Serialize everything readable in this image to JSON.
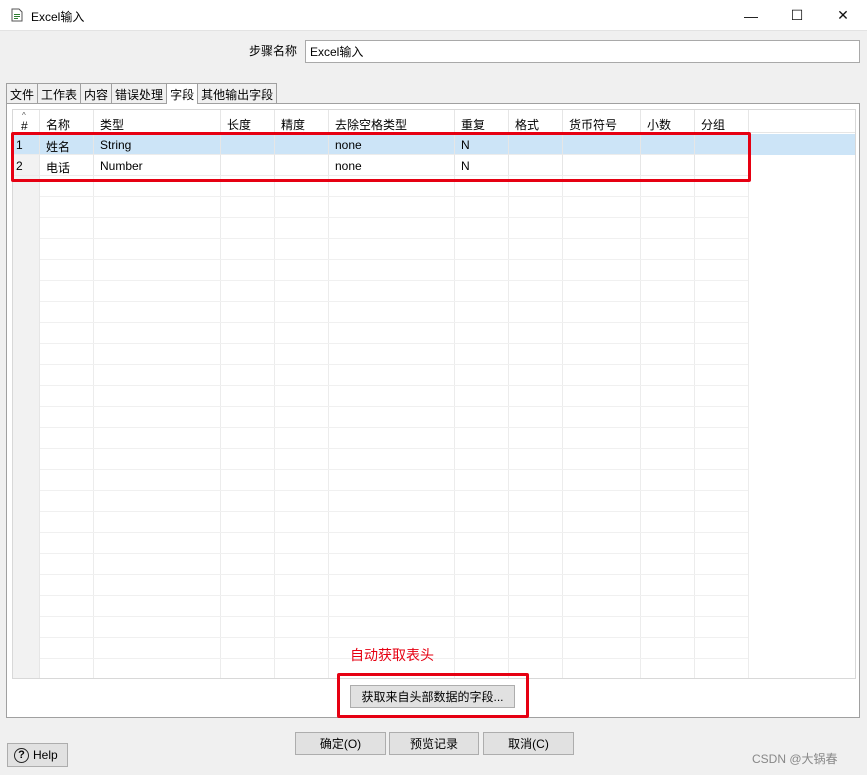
{
  "window": {
    "title": "Excel输入",
    "minimize_glyph": "—",
    "maximize_glyph": "☐",
    "close_glyph": "✕"
  },
  "step": {
    "label": "步骤名称",
    "value": "Excel输入"
  },
  "tabs": [
    "文件",
    "工作表",
    "内容",
    "错误处理",
    "字段",
    "其他输出字段"
  ],
  "active_tab": "字段",
  "table": {
    "sort_glyph": "^",
    "columns": [
      "#",
      "名称",
      "类型",
      "长度",
      "精度",
      "去除空格类型",
      "重复",
      "格式",
      "货币符号",
      "小数",
      "分组"
    ],
    "rows": [
      [
        "1",
        "姓名",
        "String",
        "",
        "",
        "none",
        "N",
        "",
        "",
        "",
        ""
      ],
      [
        "2",
        "电话",
        "Number",
        "",
        "",
        "none",
        "N",
        "",
        "",
        "",
        ""
      ]
    ]
  },
  "annotation": "自动获取表头",
  "buttons": {
    "get_fields": "获取来自头部数据的字段...",
    "ok": "确定(O)",
    "preview": "预览记录",
    "cancel": "取消(C)",
    "help": "Help",
    "help_glyph": "?"
  },
  "watermark": "CSDN @大锅春",
  "colors": {
    "selection": "#cce4f7",
    "annotation_red": "#e60012"
  }
}
